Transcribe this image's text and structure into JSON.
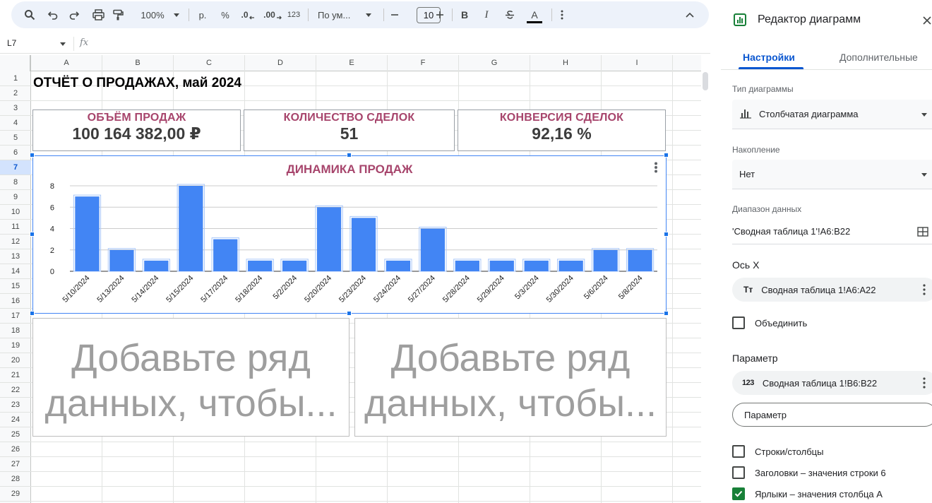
{
  "toolbar": {
    "zoom": "100%",
    "currency": "р.",
    "percent": "%",
    "dec_decrease": ".0",
    "dec_increase": ".00",
    "format_123": "123",
    "font": "По ум...",
    "font_size": "10",
    "bold": "B",
    "italic": "I",
    "text_color": "A"
  },
  "formula_bar": {
    "cell_ref": "L7",
    "fx": "fx"
  },
  "grid": {
    "columns": [
      "A",
      "B",
      "C",
      "D",
      "E",
      "F",
      "G",
      "H",
      "I"
    ],
    "rows": [
      "1",
      "2",
      "3",
      "4",
      "5",
      "6",
      "7",
      "8",
      "9",
      "10",
      "11",
      "12",
      "13",
      "14",
      "15",
      "16",
      "17",
      "18",
      "19",
      "20",
      "21",
      "22",
      "23",
      "24",
      "25",
      "26",
      "27",
      "28",
      "29"
    ],
    "selected_row": "7"
  },
  "sheet": {
    "title": "ОТЧЁТ О ПРОДАЖАХ, май 2024",
    "kpis": [
      {
        "label": "ОБЪЁМ ПРОДАЖ",
        "value": "100 164 382,00 ₽"
      },
      {
        "label": "КОЛИЧЕСТВО СДЕЛОК",
        "value": "51"
      },
      {
        "label": "КОНВЕРСИЯ СДЕЛОК",
        "value": "92,16 %"
      }
    ],
    "placeholders": [
      {
        "text": "Добавьте ряд данных, чтобы..."
      },
      {
        "text": "Добавьте ряд данных, чтобы..."
      }
    ]
  },
  "chart_data": {
    "type": "bar",
    "title": "ДИНАМИКА ПРОДАЖ",
    "categories": [
      "5/10/2024",
      "5/13/2024",
      "5/14/2024",
      "5/15/2024",
      "5/17/2024",
      "5/18/2024",
      "5/2/2024",
      "5/20/2024",
      "5/23/2024",
      "5/24/2024",
      "5/27/2024",
      "5/28/2024",
      "5/29/2024",
      "5/3/2024",
      "5/30/2024",
      "5/6/2024",
      "5/8/2024"
    ],
    "values": [
      7,
      2,
      1,
      8,
      3,
      1,
      1,
      6,
      5,
      1,
      4,
      1,
      1,
      1,
      1,
      2,
      2
    ],
    "ylim": [
      0,
      8
    ],
    "yticks": [
      "0",
      "2",
      "4",
      "6",
      "8"
    ],
    "grid": true,
    "bar_color": "#4285f4"
  },
  "panel": {
    "title": "Редактор диаграмм",
    "tabs": [
      "Настройки",
      "Дополнительные"
    ],
    "chart_type_label": "Тип диаграммы",
    "chart_type_value": "Столбчатая диаграмма",
    "stacking_label": "Накопление",
    "stacking_value": "Нет",
    "range_label": "Диапазон данных",
    "range_value": "'Сводная таблица 1'!A6:B22",
    "x_axis_title": "Ось X",
    "x_axis_chip_icon": "Тт",
    "x_axis_value": "Сводная таблица 1!A6:A22",
    "aggregate_label": "Объединить",
    "series_title": "Параметр",
    "series_chip_icon": "123",
    "series_value": "Сводная таблица 1!B6:B22",
    "series_add_button": "Параметр",
    "switch_rows_cols": "Строки/столбцы",
    "headers_option": "Заголовки – значения строки 6",
    "labels_option": "Ярлыки – значения столбца A"
  }
}
